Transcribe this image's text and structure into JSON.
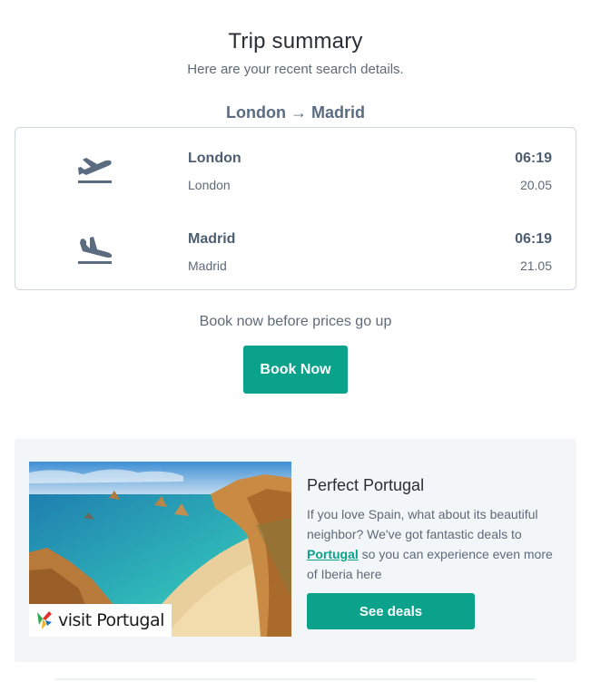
{
  "header": {
    "title": "Trip summary",
    "subtitle": "Here are your recent search details.",
    "route": "London → Madrid"
  },
  "flights": {
    "departure": {
      "icon": "takeoff-icon",
      "city": "London",
      "sub": "London",
      "time": "06:19",
      "date": "20.05"
    },
    "arrival": {
      "icon": "landing-icon",
      "city": "Madrid",
      "sub": "Madrid",
      "time": "06:19",
      "date": "21.05"
    }
  },
  "cta": {
    "prompt": "Book now before prices go up",
    "button_label": "Book Now"
  },
  "promo": {
    "image_alt": "Portugal coastline beach",
    "logo_text": "visit Portugal",
    "title": "Perfect Portugal",
    "body_before": "If you love Spain, what about its beautiful neighbor? We've got fantastic deals to ",
    "link_text": "Portugal",
    "body_after": " so you can experience even more of Iberia here",
    "button_label": "See deals"
  },
  "colors": {
    "accent": "#0aa28a",
    "icon": "#5b6b80",
    "card_border": "#cfd6de",
    "promo_bg": "#f3f6f8"
  }
}
